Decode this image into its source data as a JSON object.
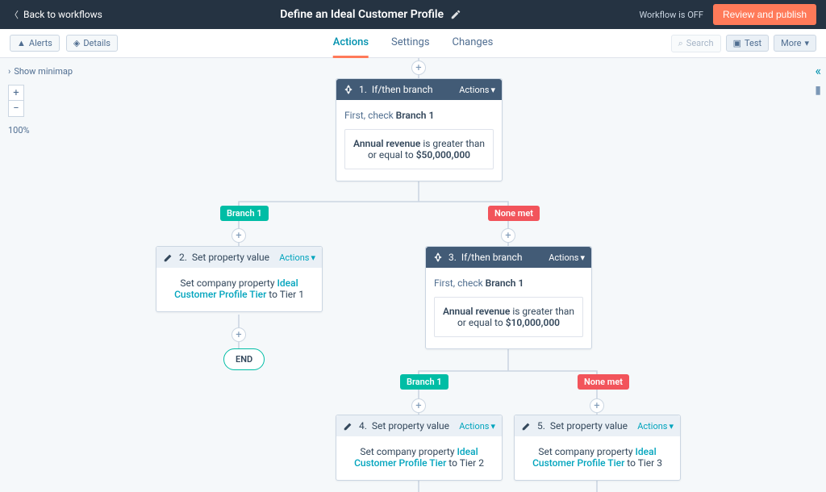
{
  "header": {
    "back_label": "Back to workflows",
    "title": "Define an Ideal Customer Profile",
    "status": "Workflow is OFF",
    "primary_button": "Review and publish"
  },
  "subnav": {
    "left": {
      "alerts": "Alerts",
      "details": "Details"
    },
    "tabs": [
      "Actions",
      "Settings",
      "Changes"
    ],
    "right": {
      "search": "Search",
      "test": "Test",
      "more": "More"
    }
  },
  "canvas": {
    "minimap_label": "Show minimap",
    "zoom_label": "100%"
  },
  "badges": {
    "branch1_a": "Branch 1",
    "nonemet_a": "None met",
    "branch1_b": "Branch 1",
    "nonemet_b": "None met"
  },
  "end_label": "END",
  "nodes": {
    "n1": {
      "title_num": "1.",
      "title": "If/then branch",
      "actions": "Actions",
      "body_prefix": "First, check ",
      "body_branch": "Branch 1",
      "rule_field": "Annual revenue",
      "rule_mid": " is greater than or equal to ",
      "rule_value": "$50,000,000"
    },
    "n2": {
      "title_num": "2.",
      "title": "Set property value",
      "actions": "Actions",
      "body_pre": "Set company property ",
      "body_link": "Ideal Customer Profile Tier",
      "body_mid": " to ",
      "body_val": "Tier 1"
    },
    "n3": {
      "title_num": "3.",
      "title": "If/then branch",
      "actions": "Actions",
      "body_prefix": "First, check ",
      "body_branch": "Branch 1",
      "rule_field": "Annual revenue",
      "rule_mid": " is greater than or equal to ",
      "rule_value": "$10,000,000"
    },
    "n4": {
      "title_num": "4.",
      "title": "Set property value",
      "actions": "Actions",
      "body_pre": "Set company property ",
      "body_link": "Ideal Customer Profile Tier",
      "body_mid": " to ",
      "body_val": "Tier 2"
    },
    "n5": {
      "title_num": "5.",
      "title": "Set property value",
      "actions": "Actions",
      "body_pre": "Set company property ",
      "body_link": "Ideal Customer Profile Tier",
      "body_mid": " to ",
      "body_val": "Tier 3"
    }
  }
}
